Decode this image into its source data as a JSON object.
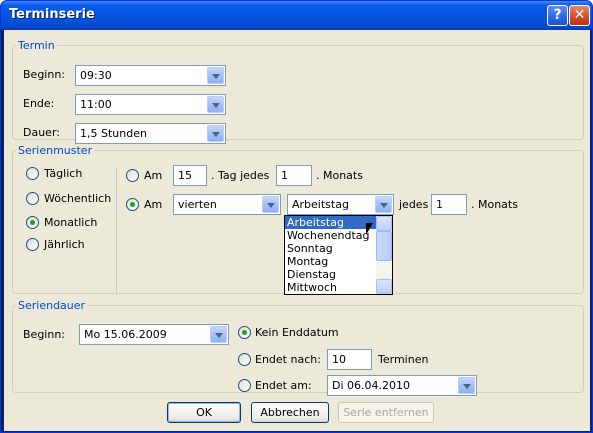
{
  "window": {
    "title": "Terminserie"
  },
  "termin": {
    "legend": "Termin",
    "beginn_label": "Beginn:",
    "beginn_value": "09:30",
    "ende_label": "Ende:",
    "ende_value": "11:00",
    "dauer_label": "Dauer:",
    "dauer_value": "1,5 Stunden"
  },
  "serienmuster": {
    "legend": "Serienmuster",
    "options": [
      "Täglich",
      "Wöchentlich",
      "Monatlich",
      "Jährlich"
    ],
    "selected": "Monatlich",
    "row1": {
      "am": "Am",
      "day": "15",
      "tag_jedes": ". Tag jedes",
      "months": "1",
      "monats": ". Monats"
    },
    "row2": {
      "am": "Am",
      "ordinal": "vierten",
      "daytype": "Arbeitstag",
      "jedes": "jedes",
      "months": "1",
      "monats": ". Monats"
    },
    "dropdown_items": [
      "Arbeitstag",
      "Wochenendtag",
      "Sonntag",
      "Montag",
      "Dienstag",
      "Mittwoch"
    ],
    "dropdown_selected": "Arbeitstag"
  },
  "seriendauer": {
    "legend": "Seriendauer",
    "beginn_label": "Beginn:",
    "beginn_value": "Mo 15.06.2009",
    "kein_enddatum": "Kein Enddatum",
    "endet_nach": "Endet nach:",
    "endet_nach_value": "10",
    "terminen": "Terminen",
    "endet_am": "Endet am:",
    "endet_am_value": "Di 06.04.2010"
  },
  "buttons": {
    "ok": "OK",
    "cancel": "Abbrechen",
    "remove": "Serie entfernen"
  },
  "colors": {
    "titlebar": "#0456e6",
    "dialog_bg": "#ece9d8",
    "group_title": "#0046d5",
    "selection": "#316ac5"
  }
}
